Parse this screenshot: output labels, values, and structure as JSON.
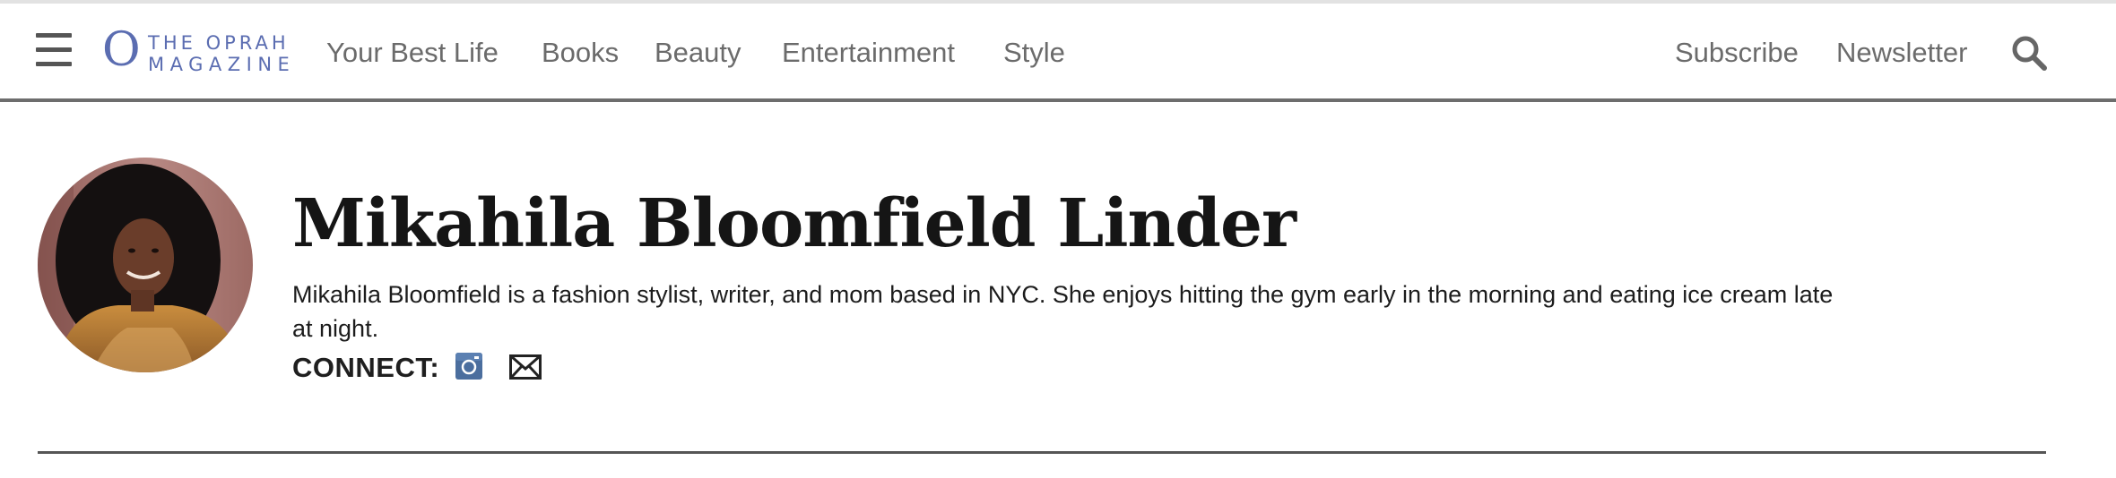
{
  "header": {
    "logo": {
      "mark": "O",
      "line1": "THE OPRAH",
      "line2": "MAGAZINE"
    },
    "nav": [
      {
        "label": "Your Best Life"
      },
      {
        "label": "Books"
      },
      {
        "label": "Beauty"
      },
      {
        "label": "Entertainment"
      },
      {
        "label": "Style"
      }
    ],
    "actions": {
      "subscribe": "Subscribe",
      "newsletter": "Newsletter"
    }
  },
  "author": {
    "name": "Mikahila Bloomfield Linder",
    "bio": "Mikahila Bloomfield is a fashion stylist, writer, and mom based in NYC. She enjoys hitting the gym early in the morning and eating ice cream late at night.",
    "connect_label": "CONNECT:",
    "social": [
      {
        "icon": "instagram-icon"
      },
      {
        "icon": "email-icon"
      }
    ]
  },
  "colors": {
    "brand": "#5b6db1",
    "nav_text": "#6b6b6b",
    "icon_accent": "#4b6e9e"
  }
}
